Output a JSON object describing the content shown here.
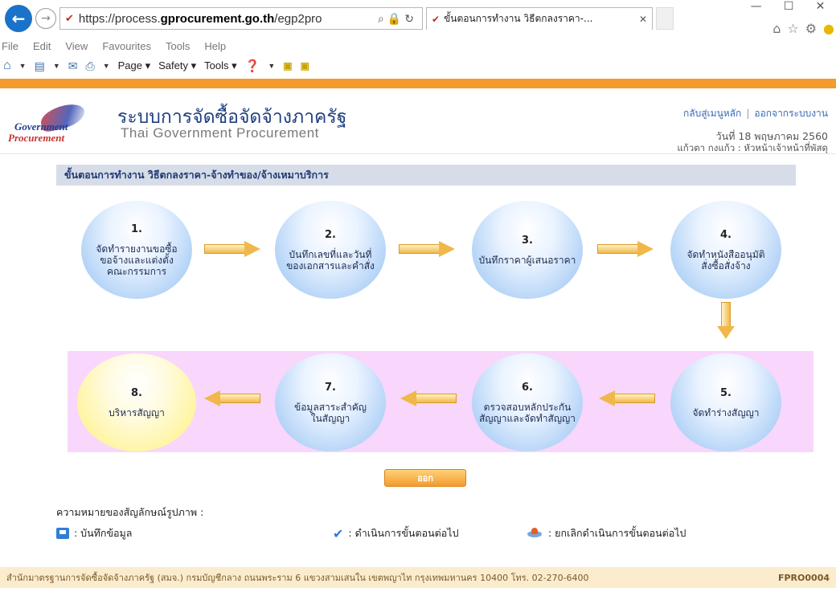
{
  "browser": {
    "url_prefix": "https://process.",
    "url_domain": "gprocurement.go.th",
    "url_suffix": "/egp2pro",
    "tab_title": "ขั้นตอนการทำงาน วิธีตกลงราคา-...",
    "menu": [
      "File",
      "Edit",
      "View",
      "Favourites",
      "Tools",
      "Help"
    ],
    "commands": {
      "page": "Page",
      "safety": "Safety",
      "tools": "Tools"
    }
  },
  "header": {
    "title_th": "ระบบการจัดซื้อจัดจ้างภาครัฐ",
    "title_en": "Thai Government Procurement",
    "logo_line1": "Government",
    "logo_line2": "Procurement",
    "link_main_menu": "กลับสู่เมนูหลัก",
    "link_logout": "ออกจากระบบงาน",
    "date": "วันที่ 18 พฤษภาคม 2560",
    "user": "แก้วตา กงแก้ว : หัวหน้าเจ้าหน้าที่พัสดุ"
  },
  "section_title": "ขั้นตอนการทำงาน วิธีตกลงราคา-จ้างทำของ/จ้างเหมาบริการ",
  "steps": [
    {
      "num": "1.",
      "text": "จัดทำรายงานขอซื้อ\nขอจ้างและแต่งตั้ง\nคณะกรรมการ"
    },
    {
      "num": "2.",
      "text": "บันทึกเลขที่และวันที่\nของเอกสารและคำสั่ง"
    },
    {
      "num": "3.",
      "text": "บันทึกราคาผู้เสนอราคา"
    },
    {
      "num": "4.",
      "text": "จัดทำหนังสืออนุมัติ\nสั่งซื้อสั่งจ้าง"
    },
    {
      "num": "5.",
      "text": "จัดทำร่างสัญญา"
    },
    {
      "num": "6.",
      "text": "ตรวจสอบหลักประกัน\nสัญญาและจัดทำสัญญา"
    },
    {
      "num": "7.",
      "text": "ข้อมูลสาระสำคัญ\nในสัญญา"
    },
    {
      "num": "8.",
      "text": "บริหารสัญญา"
    }
  ],
  "exit_button": "ออก",
  "legend": {
    "title": "ความหมายของสัญลักษณ์รูปภาพ :",
    "save": ": บันทึกข้อมูล",
    "proceed": ": ดำเนินการขั้นตอนต่อไป",
    "cancel": ": ยกเลิกดำเนินการขั้นตอนต่อไป"
  },
  "footer": {
    "address": "สำนักมาตรฐานการจัดซื้อจัดจ้างภาครัฐ (สมจ.) กรมบัญชีกลาง ถนนพระราม 6 แขวงสามเสนใน เขตพญาไท กรุงเทพมหานคร 10400 โทร. 02-270-6400",
    "code": "FPRO0004"
  },
  "colors": {
    "accent_orange": "#f39b2c",
    "pink_band": "#f9d6fb",
    "step_blue": "#aed0f6",
    "final_yellow": "#fff49a"
  }
}
